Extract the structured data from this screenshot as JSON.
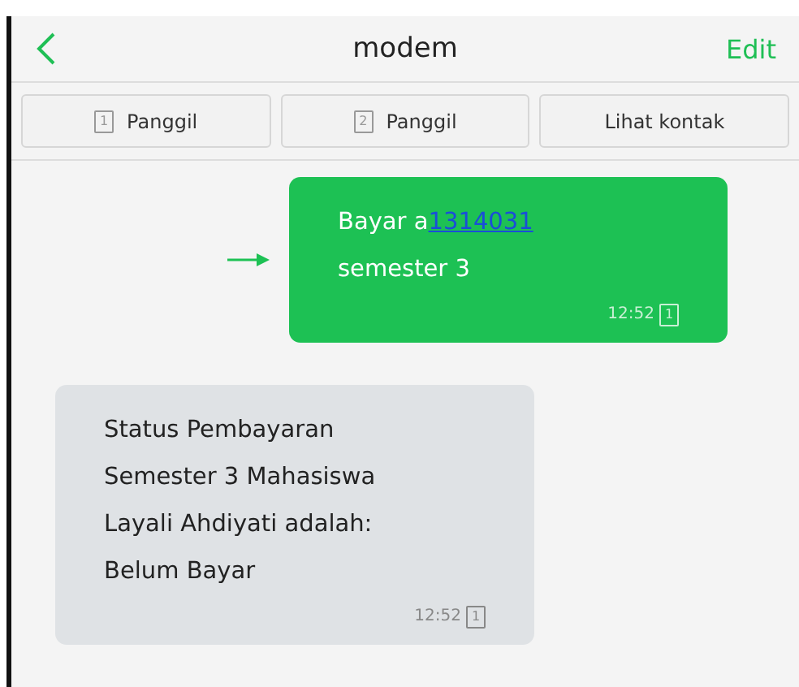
{
  "header": {
    "title": "modem",
    "action": "Edit"
  },
  "buttons": [
    {
      "sim": "1",
      "label": "Panggil"
    },
    {
      "sim": "2",
      "label": "Panggil"
    },
    {
      "label": "Lihat kontak"
    }
  ],
  "messages": [
    {
      "kind": "outgoing",
      "lines": [
        [
          {
            "kind": "text",
            "text": "Bayar a"
          },
          {
            "kind": "link",
            "text": "1314031"
          }
        ],
        [
          {
            "kind": "text",
            "text": "semester 3"
          }
        ]
      ],
      "time": "12:52",
      "sim": "1"
    },
    {
      "kind": "incoming",
      "lines": [
        [
          {
            "kind": "text",
            "text": "Status Pembayaran"
          }
        ],
        [
          {
            "kind": "text",
            "text": "Semester 3  Mahasiswa"
          }
        ],
        [
          {
            "kind": "text",
            "text": "Layali Ahdiyati adalah:"
          }
        ],
        [
          {
            "kind": "text",
            "text": "Belum Bayar"
          }
        ]
      ],
      "time": "12:52",
      "sim": "1"
    }
  ]
}
